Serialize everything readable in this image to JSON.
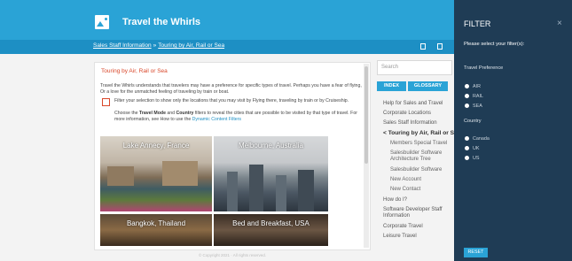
{
  "header": {
    "site_title": "Travel the Whirls",
    "breadcrumb": [
      "Sales Staff Information",
      "Touring by Air, Rail or Sea"
    ],
    "breadcrumb_separator": "»",
    "brand_color": "#2aa3d6"
  },
  "article": {
    "title": "Touring by Air, Rail or Sea",
    "intro": "Travel the Whirls understands that travelers may have a preference for specific types of travel. Perhaps you have a fear of flying, Or a love for the unmatched feeling of traveling by train or boat.",
    "checkbox_text": "Filter your selection to show only the locations that you may visit by Flying there, traveling by train or by Cruiseship.",
    "guide_prefix": "Choose the ",
    "guide_bold1": "Travel Mode",
    "guide_mid": " and ",
    "guide_bold2": "Country",
    "guide_rest": " filters to reveal the cities that are possible to be visited by that type of travel. For more information, see How to use the ",
    "guide_link": "Dynamic Content Filters",
    "tiles": [
      {
        "label": "Lake Annecy, France"
      },
      {
        "label": "Melbourne, Australia"
      },
      {
        "label": "Bangkok, Thailand"
      },
      {
        "label": "Bed and Breakfast, USA"
      }
    ],
    "copyright": "© Copyright 2021 · All rights reserved."
  },
  "sidebar": {
    "search_placeholder": "Search",
    "index_button": "INDEX",
    "glossary_button": "GLOSSARY",
    "items": [
      {
        "label": "Help for Sales and Travel"
      },
      {
        "label": "Corporate Locations"
      },
      {
        "label": "Sales Staff Information"
      },
      {
        "label": "Touring by Air, Rail or Sea"
      },
      {
        "label": "Members Special Travel"
      },
      {
        "label": "Salesbuilder Software Architecture Tree"
      },
      {
        "label": "Salesbuilder Software"
      },
      {
        "label": "New Account"
      },
      {
        "label": "New Contact"
      },
      {
        "label": "How do I?"
      },
      {
        "label": "Software Developer Staff Information"
      },
      {
        "label": "Corporate Travel"
      },
      {
        "label": "Leisure Travel"
      }
    ],
    "expand_glyph": "<"
  },
  "filter": {
    "title": "FILTER",
    "close_glyph": "×",
    "prompt": "Please select your filter(s):",
    "travel_heading": "Travel Preference",
    "travel_options": [
      "AIR",
      "RAIL",
      "SEA"
    ],
    "country_heading": "Country",
    "country_options": [
      "Canada",
      "UK",
      "US"
    ],
    "reset_label": "RESET",
    "panel_color": "#1f3c55"
  }
}
